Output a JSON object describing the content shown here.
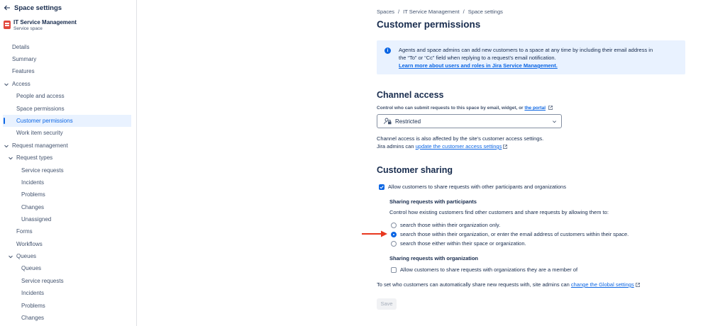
{
  "sidebar": {
    "title": "Space settings",
    "project": {
      "name": "IT Service Management",
      "type": "Service space"
    },
    "items": [
      {
        "label": "Details"
      },
      {
        "label": "Summary"
      },
      {
        "label": "Features"
      },
      {
        "label": "Access"
      },
      {
        "label": "People and access"
      },
      {
        "label": "Space permissions"
      },
      {
        "label": "Customer permissions"
      },
      {
        "label": "Work item security"
      },
      {
        "label": "Request management"
      },
      {
        "label": "Request types"
      },
      {
        "label": "Service requests"
      },
      {
        "label": "Incidents"
      },
      {
        "label": "Problems"
      },
      {
        "label": "Changes"
      },
      {
        "label": "Unassigned"
      },
      {
        "label": "Forms"
      },
      {
        "label": "Workflows"
      },
      {
        "label": "Queues"
      },
      {
        "label": "Queues"
      },
      {
        "label": "Service requests"
      },
      {
        "label": "Incidents"
      },
      {
        "label": "Problems"
      },
      {
        "label": "Changes"
      }
    ]
  },
  "breadcrumb": [
    "Spaces",
    "IT Service Management",
    "Space settings"
  ],
  "page_title": "Customer permissions",
  "info": {
    "line1": "Agents and space admins can add new customers to a space at any time by including their email address in",
    "line2": "the “To” or “Cc” field when replying to a request’s email notification.",
    "link": "Learn more about users and roles in Jira Service Management."
  },
  "channel_access": {
    "heading": "Channel access",
    "label": "Control who can submit requests to this space by email, widget, or",
    "label_link": "the portal",
    "selected": "Restricted",
    "note_line1": "Channel access is also affected by the site’s customer access settings.",
    "note_line2_prefix": "Jira admins can",
    "note_link": "update the customer access settings"
  },
  "customer_sharing": {
    "heading": "Customer sharing",
    "allow_label": "Allow customers to share requests with other participants and organizations",
    "allow_checked": true,
    "participants_heading": "Sharing requests with participants",
    "participants_desc": "Control how existing customers find other customers and share requests by allowing them to:",
    "options": [
      {
        "label": "search those within their organization only.",
        "selected": false
      },
      {
        "label": "search those within their organization, or enter the email address of customers within their space.",
        "selected": true
      },
      {
        "label": "search those either within their space or organization.",
        "selected": false
      }
    ],
    "org_heading": "Sharing requests with organization",
    "org_label": "Allow customers to share requests with organizations they are a member of",
    "org_checked": false,
    "global_prefix": "To set who customers can automatically share new requests with, site admins can",
    "global_link": "change the Global settings"
  },
  "save_label": "Save",
  "colors": {
    "accent": "#0c66e4",
    "annotation_arrow": "#e8381f",
    "info_bg": "#e9f2ff"
  }
}
